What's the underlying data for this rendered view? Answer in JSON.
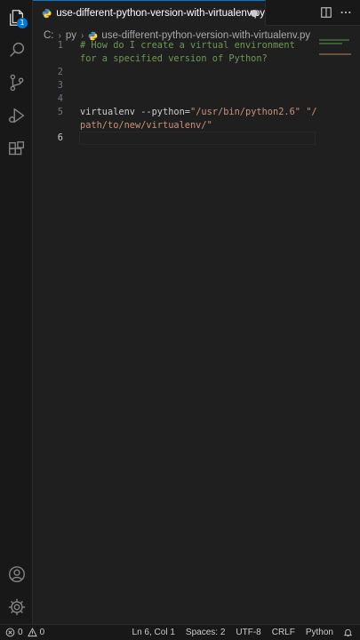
{
  "activity_bar": {
    "items": [
      "explorer-icon",
      "search-icon",
      "source-control-icon",
      "run-debug-icon",
      "extensions-icon"
    ],
    "explorer_badge": "1",
    "bottom": [
      "account-icon",
      "manage-gear-icon"
    ]
  },
  "tab": {
    "label": "use-different-python-version-with-virtualenv.py",
    "modified": true
  },
  "breadcrumb": {
    "drive": "C:",
    "folder": "py",
    "file": "use-different-python-version-with-virtualenv.py"
  },
  "editor": {
    "line_numbers": [
      "1",
      "2",
      "3",
      "4",
      "5",
      "6"
    ],
    "active_line": "6",
    "code": {
      "l1a": "# How do I create a virtual environment",
      "l1b": "for a specified version of Python?",
      "l5_ident": "virtualenv ",
      "l5_flag": "--python=",
      "l5_str1": "\"/usr/bin/python2.6\"",
      "l5_space": " ",
      "l5_str2a": "\"/",
      "l5_str2b": "path/to/new/virtualenv/\""
    }
  },
  "status_bar": {
    "errors": "0",
    "warnings": "0",
    "position": "Ln 6, Col 1",
    "spaces": "Spaces: 2",
    "encoding": "UTF-8",
    "eol": "CRLF",
    "language": "Python"
  },
  "colors": {
    "accent": "#0078d4",
    "comment": "#6a9955",
    "string": "#ce9178",
    "background": "#1f1f1f"
  }
}
